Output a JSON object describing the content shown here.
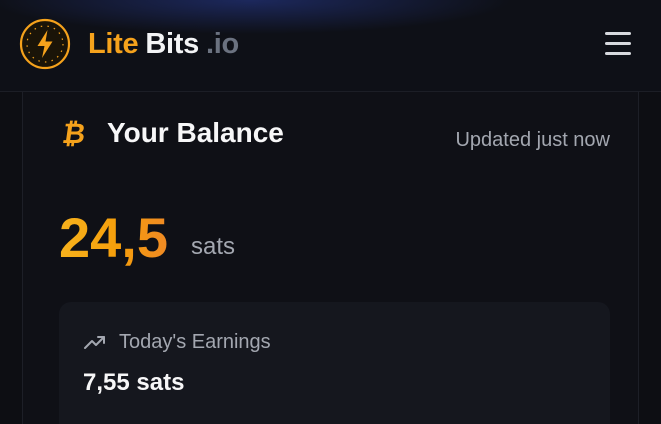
{
  "header": {
    "logo_icon": "lightning-bolt-coin-icon",
    "brand_lite": "Lite",
    "brand_bits": "Bits",
    "brand_domain": ".io",
    "menu_icon": "hamburger-menu-icon"
  },
  "balance_card": {
    "icon": "bitcoin-icon",
    "title": "Your Balance",
    "updated": "Updated just now",
    "amount": "24,5",
    "unit": "sats",
    "earnings": {
      "icon": "trending-up-icon",
      "label": "Today's Earnings",
      "value": "7,55 sats"
    }
  },
  "colors": {
    "accent_orange": "#f59e0b",
    "background": "#0d0e13",
    "card_background": "#15171e",
    "muted_text": "#a3a7b0"
  }
}
